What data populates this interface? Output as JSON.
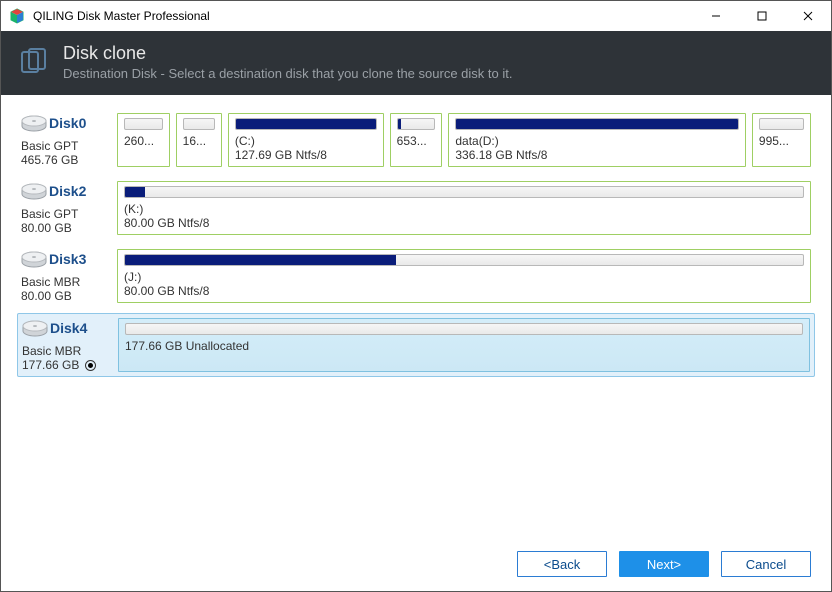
{
  "window": {
    "title": "QILING Disk Master Professional"
  },
  "header": {
    "title": "Disk clone",
    "subtitle": "Destination Disk - Select a destination disk that you clone the source disk to it."
  },
  "disks": [
    {
      "name": "Disk0",
      "type": "Basic GPT",
      "size": "465.76 GB",
      "selected": false,
      "partitions": [
        {
          "label1": "",
          "label2": "260...",
          "fill": 0,
          "flex": 0.6
        },
        {
          "label1": "",
          "label2": "16...",
          "fill": 0,
          "flex": 0.5
        },
        {
          "label1": "(C:)",
          "label2": "127.69 GB Ntfs/8",
          "fill": 100,
          "flex": 2.2
        },
        {
          "label1": "",
          "label2": "653...",
          "fill": 10,
          "flex": 0.6
        },
        {
          "label1": "data(D:)",
          "label2": "336.18 GB Ntfs/8",
          "fill": 100,
          "flex": 4.4
        },
        {
          "label1": "",
          "label2": "995...",
          "fill": 0,
          "flex": 0.7
        }
      ]
    },
    {
      "name": "Disk2",
      "type": "Basic GPT",
      "size": "80.00 GB",
      "selected": false,
      "partitions": [
        {
          "label1": "(K:)",
          "label2": "80.00 GB Ntfs/8",
          "fill": 3,
          "flex": 1
        }
      ]
    },
    {
      "name": "Disk3",
      "type": "Basic MBR",
      "size": "80.00 GB",
      "selected": false,
      "partitions": [
        {
          "label1": "(J:)",
          "label2": "80.00 GB Ntfs/8",
          "fill": 40,
          "flex": 1
        }
      ]
    },
    {
      "name": "Disk4",
      "type": "Basic MBR",
      "size": "177.66 GB",
      "selected": true,
      "partitions": [
        {
          "label1": "",
          "label2": "177.66 GB Unallocated",
          "fill": 0,
          "flex": 1,
          "unalloc": true
        }
      ]
    }
  ],
  "buttons": {
    "back": "<Back",
    "next": "Next>",
    "cancel": "Cancel"
  }
}
